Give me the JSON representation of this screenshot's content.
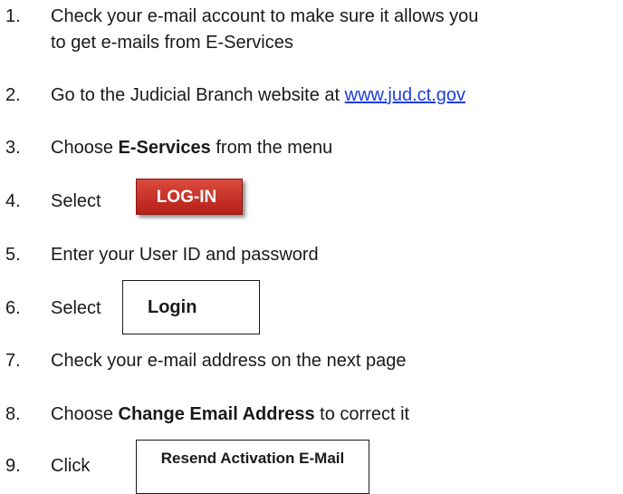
{
  "steps": [
    {
      "num": "1.",
      "line1": "Check your e-mail account to make sure it allows you",
      "line2": "to get e-mails from E-Services"
    },
    {
      "num": "2.",
      "pre": "Go to the Judicial Branch website at ",
      "link": "www.jud.ct.gov"
    },
    {
      "num": "3.",
      "pre": "Choose ",
      "bold": "E-Services",
      "post": " from the menu"
    },
    {
      "num": "4.",
      "text": "Select",
      "button": "LOG-IN"
    },
    {
      "num": "5.",
      "text": "Enter your User ID and password"
    },
    {
      "num": "6.",
      "text": "Select",
      "button": "Login"
    },
    {
      "num": "7.",
      "text": "Check your e-mail address on the next page"
    },
    {
      "num": "8.",
      "pre": "Choose ",
      "bold": "Change Email Address",
      "post": " to correct it"
    },
    {
      "num": "9.",
      "text": "Click",
      "button": "Resend Activation E-Mail"
    }
  ],
  "colors": {
    "link": "#1a3de0",
    "login_red": "#c0281f"
  }
}
